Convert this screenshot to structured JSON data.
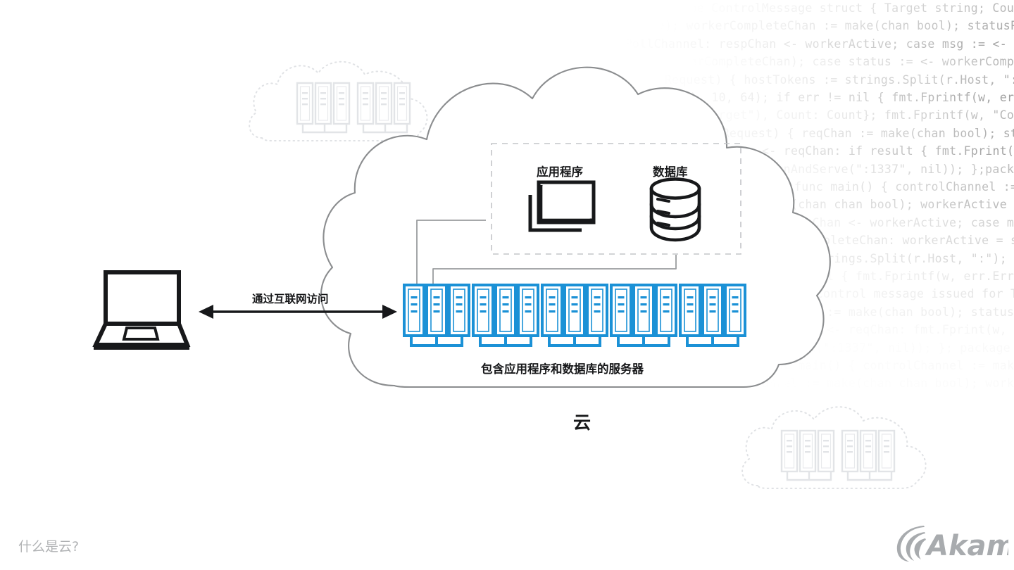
{
  "page": {
    "caption": "什么是云?",
    "background_color": "#ffffff",
    "accent_blue": "#1b91d6",
    "outline_gray": "#8b8d8f",
    "ink": "#17181a",
    "faint_gray": "#e4e6e8"
  },
  "diagram": {
    "cloud_label": "云",
    "internet_arrow_label": "通过互联网访问",
    "app_label": "应用程序",
    "database_label": "数据库",
    "servers_caption": "包含应用程序和数据库的服务器",
    "server_group_count": 5,
    "racks_per_group": 3,
    "rack_slot_lines": 3,
    "ghost_cloud_count": 2,
    "ghost_cloud_racks": 6,
    "icons": {
      "laptop": "laptop-icon",
      "app": "stacked-windows-icon",
      "database": "database-cylinder-icon",
      "server": "server-rack-icon",
      "arrow": "double-arrow-icon",
      "logo": "akamai-logo"
    }
  },
  "logo": {
    "wordmark": "Akamai"
  },
  "code_background": {
    "font_color": "#9a9a9a",
    "lines": [
      "chanList := []string{ \"dmn\", \"cimn\" }; type ControlMessage struct { Target string; Count int64; }; func main()",
      "controlChannel := make(chan ControlMessage); workerCompleteChan := make(chan bool); statusPollChannel := make(chan chan bool); workerActive := false",
      "for { select { case respChan := <- statusPollChannel: respChan <- workerActive; case msg := <- controlChannel:",
      "workerActive = true; go doStuff(msg, workerCompleteChan); case status := <- workerCompleteChan: workerActive = status;",
      "func admin(w http.ResponseWriter, r *http.Request) { hostTokens := strings.Split(r.Host, \":\")",
      "Count, err := strconv.ParseInt(r.FormValue(\"count\"), 10, 64); if err != nil { fmt.Fprintf(w, err.Error()); return; }",
      "msg := ControlMessage{Target: r.FormValue(\"target\"), Count: Count}; fmt.Fprintf(w, \"Control message issued for Target %s\", msg.Target)",
      "func statusHandler(w http.ResponseWriter, r *http.Request) { reqChan := make(chan bool); statusPollChannel <- reqChan",
      "timeout := time.After(time.Second); select { case result := <- reqChan: if result { fmt.Fprint(w, \"ACTIVE\"); return; }",
      "http.HandleFunc(\"/admin\", admin); log.Fatal(http.ListenAndServe(\":1337\", nil)); };package main; import ( \"fmt\"; \"net/http\" )",
      "type ControlMessage struct { Target string; Count int64; }; func main() { controlChannel := make(chan ControlMessage)",
      "workerCompleteChan := make(chan bool); statusPollChannel := make(chan chan bool); workerActive := false; go admin(controlChannel",
      "for { select { case respChan := <- statusPollChannel: respChan <- workerActive; case msg := <- controlChannel: workerActive",
      "go doStuff(msg, workerCompleteChan); case status := <- workerCompleteChan: workerActive = status; }}}; func admin(c chan",
      "func admin(w http.ResponseWriter, r *http.Request) { hostTokens := strings.Split(r.Host, \":\"); Count, err :=",
      "strconv.ParseInt(r.FormValue(\"count\"), 10, 64); if err != nil { fmt.Fprintf(w, err.Error()); return; }; msg :=",
      "ControlMessage{Target: r.FormValue(\"target\")}; fmt.Fprintf(w, \"Control message issued for Target %s\", msg.Target)",
      "func statusHandler(w http.ResponseWriter, r *http.Request) { reqChan := make(chan bool); statusPollChannel <- reqChan",
      "timeout := time.After(time.Second); select { case result := <- reqChan: fmt.Fprint(w, \"ACTIVE\"); return; }",
      "http.HandleFunc(\"/admin\", admin); log.Fatal(http.ListenAndServe(\":1337\", nil)); }; package main; import ( \"fmt\" )",
      "type ControlMessage struct { Target string; Count int64; }; func main() { controlChannel := make(chan ControlMessage)",
      "workerCompleteChan := make(chan bool); statusPollChannel := make(chan chan bool); workerActive := false; go admin(c"
    ]
  }
}
